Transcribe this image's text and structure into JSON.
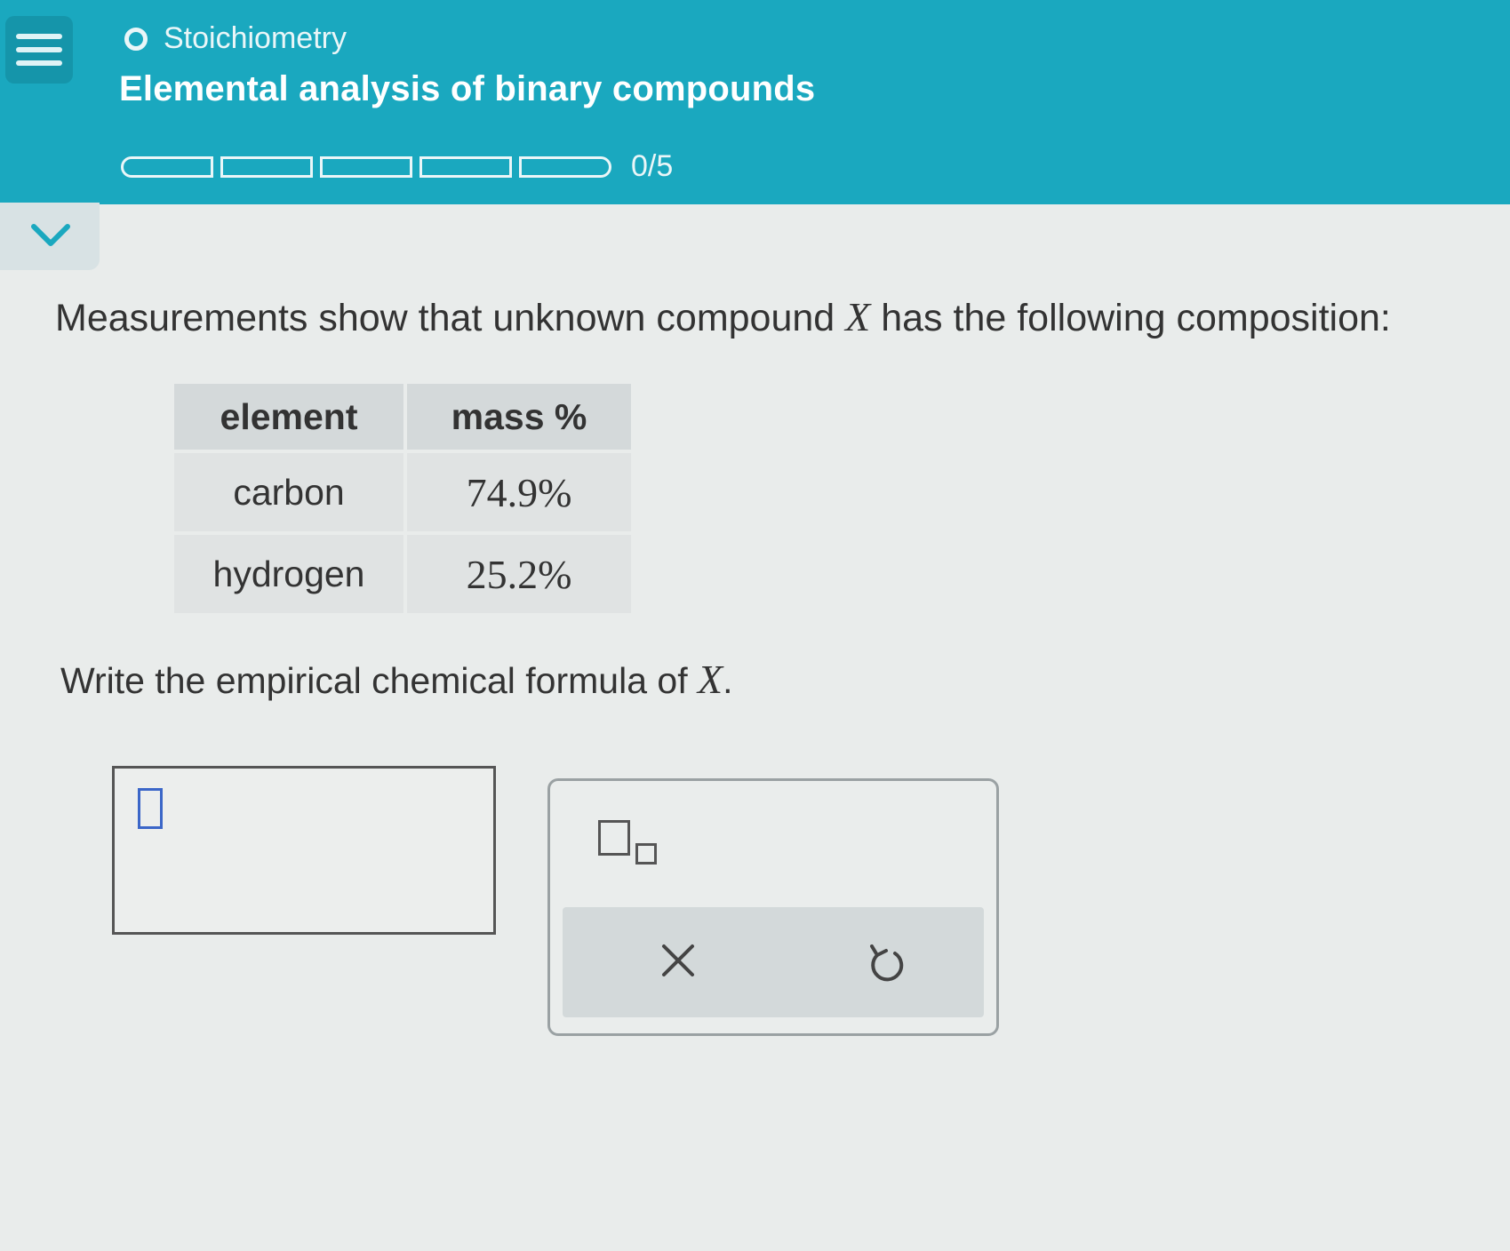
{
  "header": {
    "topic": "Stoichiometry",
    "title": "Elemental analysis of binary compounds",
    "progress_text": "0/5",
    "progress": {
      "completed": 0,
      "total": 5
    },
    "background_color": "#1aa8bf"
  },
  "question": {
    "intro_before": "Measurements show that unknown compound ",
    "variable": "X",
    "intro_after": " has the following composition:",
    "table": {
      "headers": [
        "element",
        "mass %"
      ],
      "rows": [
        [
          "carbon",
          "74.9%"
        ],
        [
          "hydrogen",
          "25.2%"
        ]
      ]
    },
    "prompt_before": "Write the empirical chemical formula of ",
    "prompt_variable": "X",
    "prompt_after": "."
  },
  "answer": {
    "value": ""
  },
  "toolbox": {
    "subscript_tool": "subscript-icon",
    "clear_symbol": "×",
    "undo_symbol": "undo-icon"
  }
}
